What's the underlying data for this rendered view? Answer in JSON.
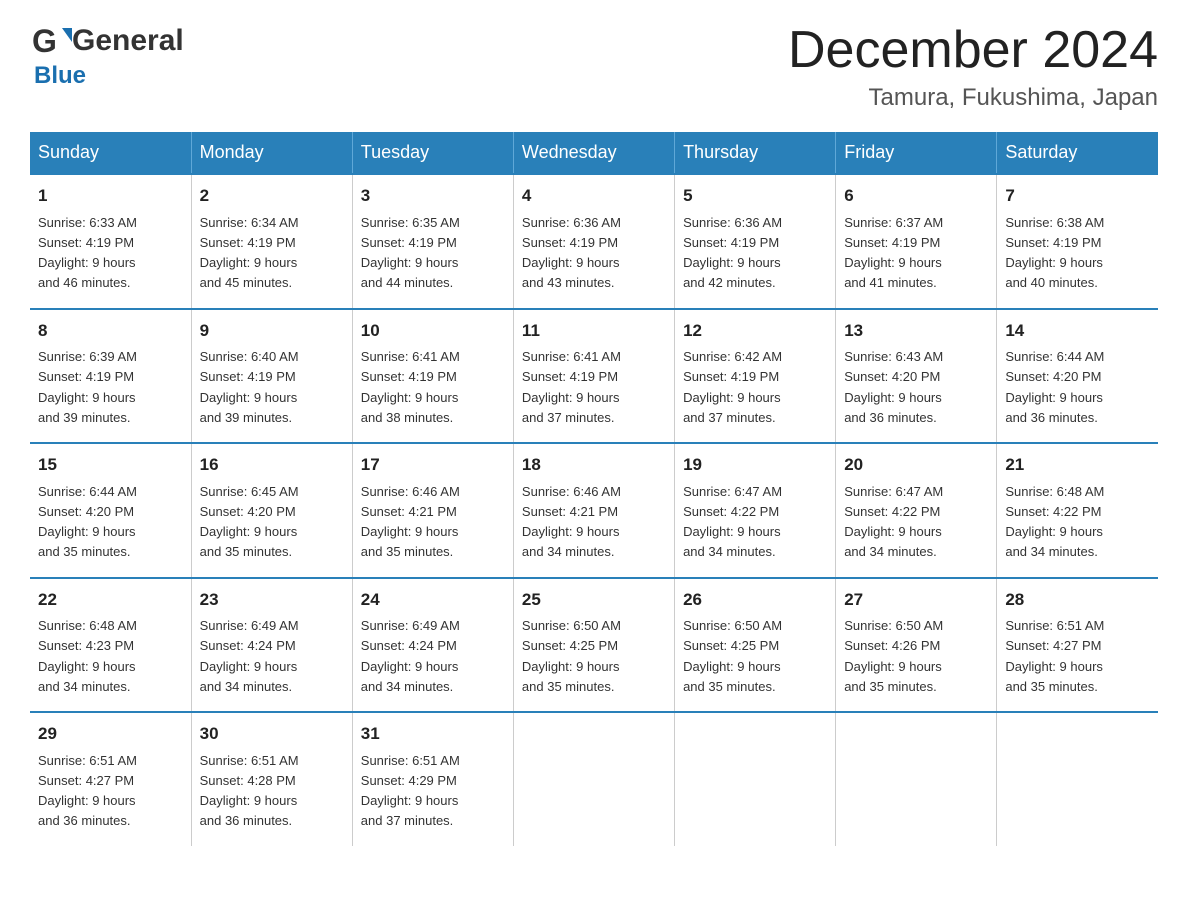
{
  "header": {
    "logo_general": "General",
    "logo_blue": "Blue",
    "month": "December 2024",
    "location": "Tamura, Fukushima, Japan"
  },
  "weekdays": [
    "Sunday",
    "Monday",
    "Tuesday",
    "Wednesday",
    "Thursday",
    "Friday",
    "Saturday"
  ],
  "weeks": [
    [
      {
        "day": "1",
        "sunrise": "6:33 AM",
        "sunset": "4:19 PM",
        "daylight": "9 hours and 46 minutes."
      },
      {
        "day": "2",
        "sunrise": "6:34 AM",
        "sunset": "4:19 PM",
        "daylight": "9 hours and 45 minutes."
      },
      {
        "day": "3",
        "sunrise": "6:35 AM",
        "sunset": "4:19 PM",
        "daylight": "9 hours and 44 minutes."
      },
      {
        "day": "4",
        "sunrise": "6:36 AM",
        "sunset": "4:19 PM",
        "daylight": "9 hours and 43 minutes."
      },
      {
        "day": "5",
        "sunrise": "6:36 AM",
        "sunset": "4:19 PM",
        "daylight": "9 hours and 42 minutes."
      },
      {
        "day": "6",
        "sunrise": "6:37 AM",
        "sunset": "4:19 PM",
        "daylight": "9 hours and 41 minutes."
      },
      {
        "day": "7",
        "sunrise": "6:38 AM",
        "sunset": "4:19 PM",
        "daylight": "9 hours and 40 minutes."
      }
    ],
    [
      {
        "day": "8",
        "sunrise": "6:39 AM",
        "sunset": "4:19 PM",
        "daylight": "9 hours and 39 minutes."
      },
      {
        "day": "9",
        "sunrise": "6:40 AM",
        "sunset": "4:19 PM",
        "daylight": "9 hours and 39 minutes."
      },
      {
        "day": "10",
        "sunrise": "6:41 AM",
        "sunset": "4:19 PM",
        "daylight": "9 hours and 38 minutes."
      },
      {
        "day": "11",
        "sunrise": "6:41 AM",
        "sunset": "4:19 PM",
        "daylight": "9 hours and 37 minutes."
      },
      {
        "day": "12",
        "sunrise": "6:42 AM",
        "sunset": "4:19 PM",
        "daylight": "9 hours and 37 minutes."
      },
      {
        "day": "13",
        "sunrise": "6:43 AM",
        "sunset": "4:20 PM",
        "daylight": "9 hours and 36 minutes."
      },
      {
        "day": "14",
        "sunrise": "6:44 AM",
        "sunset": "4:20 PM",
        "daylight": "9 hours and 36 minutes."
      }
    ],
    [
      {
        "day": "15",
        "sunrise": "6:44 AM",
        "sunset": "4:20 PM",
        "daylight": "9 hours and 35 minutes."
      },
      {
        "day": "16",
        "sunrise": "6:45 AM",
        "sunset": "4:20 PM",
        "daylight": "9 hours and 35 minutes."
      },
      {
        "day": "17",
        "sunrise": "6:46 AM",
        "sunset": "4:21 PM",
        "daylight": "9 hours and 35 minutes."
      },
      {
        "day": "18",
        "sunrise": "6:46 AM",
        "sunset": "4:21 PM",
        "daylight": "9 hours and 34 minutes."
      },
      {
        "day": "19",
        "sunrise": "6:47 AM",
        "sunset": "4:22 PM",
        "daylight": "9 hours and 34 minutes."
      },
      {
        "day": "20",
        "sunrise": "6:47 AM",
        "sunset": "4:22 PM",
        "daylight": "9 hours and 34 minutes."
      },
      {
        "day": "21",
        "sunrise": "6:48 AM",
        "sunset": "4:22 PM",
        "daylight": "9 hours and 34 minutes."
      }
    ],
    [
      {
        "day": "22",
        "sunrise": "6:48 AM",
        "sunset": "4:23 PM",
        "daylight": "9 hours and 34 minutes."
      },
      {
        "day": "23",
        "sunrise": "6:49 AM",
        "sunset": "4:24 PM",
        "daylight": "9 hours and 34 minutes."
      },
      {
        "day": "24",
        "sunrise": "6:49 AM",
        "sunset": "4:24 PM",
        "daylight": "9 hours and 34 minutes."
      },
      {
        "day": "25",
        "sunrise": "6:50 AM",
        "sunset": "4:25 PM",
        "daylight": "9 hours and 35 minutes."
      },
      {
        "day": "26",
        "sunrise": "6:50 AM",
        "sunset": "4:25 PM",
        "daylight": "9 hours and 35 minutes."
      },
      {
        "day": "27",
        "sunrise": "6:50 AM",
        "sunset": "4:26 PM",
        "daylight": "9 hours and 35 minutes."
      },
      {
        "day": "28",
        "sunrise": "6:51 AM",
        "sunset": "4:27 PM",
        "daylight": "9 hours and 35 minutes."
      }
    ],
    [
      {
        "day": "29",
        "sunrise": "6:51 AM",
        "sunset": "4:27 PM",
        "daylight": "9 hours and 36 minutes."
      },
      {
        "day": "30",
        "sunrise": "6:51 AM",
        "sunset": "4:28 PM",
        "daylight": "9 hours and 36 minutes."
      },
      {
        "day": "31",
        "sunrise": "6:51 AM",
        "sunset": "4:29 PM",
        "daylight": "9 hours and 37 minutes."
      },
      null,
      null,
      null,
      null
    ]
  ],
  "labels": {
    "sunrise_prefix": "Sunrise: ",
    "sunset_prefix": "Sunset: ",
    "daylight_prefix": "Daylight: "
  }
}
